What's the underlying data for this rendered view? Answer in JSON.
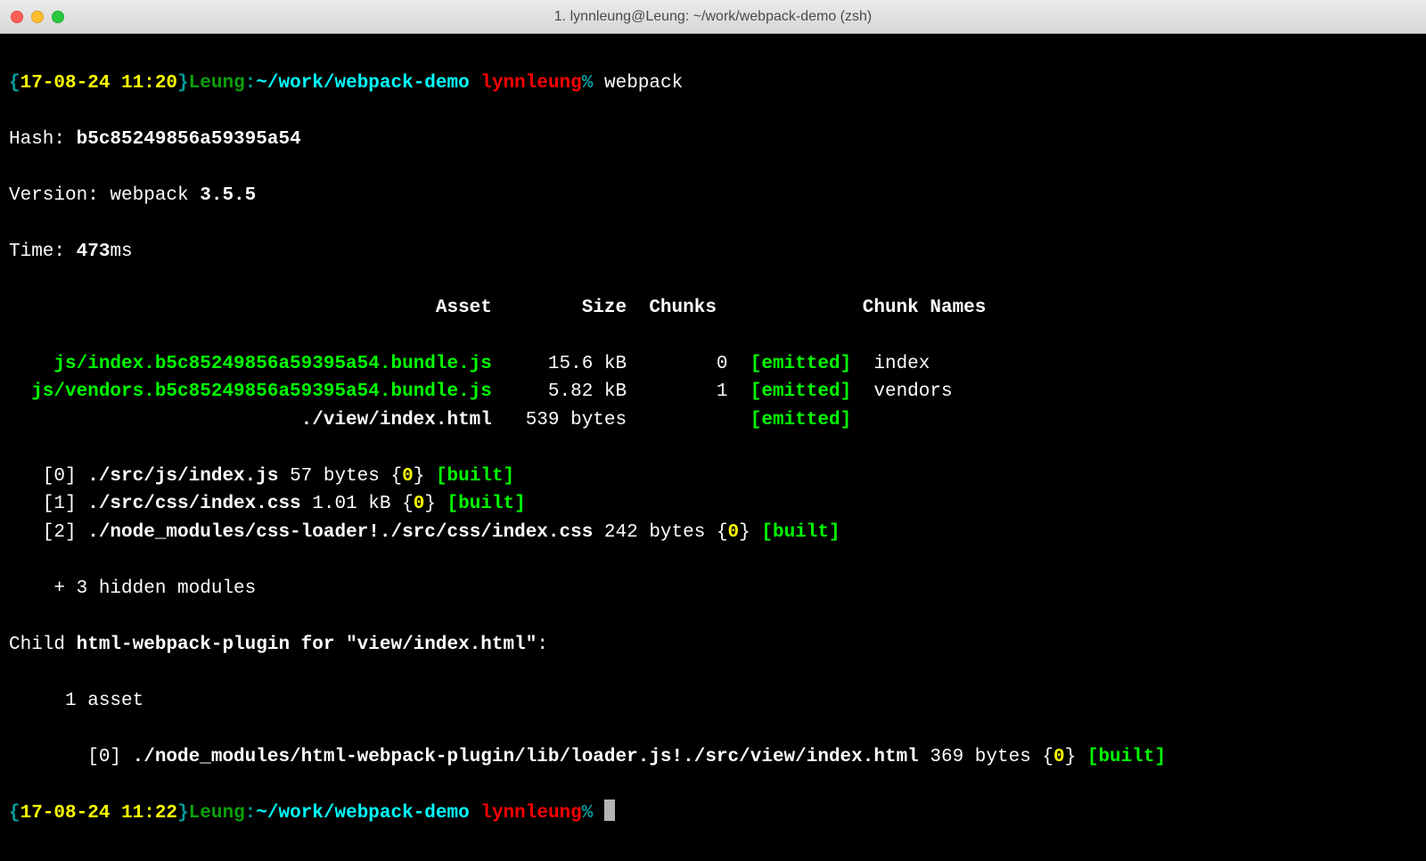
{
  "window": {
    "title": "1. lynnleung@Leung: ~/work/webpack-demo (zsh)"
  },
  "prompt1": {
    "open": "{",
    "timestamp": "17-08-24 11:20",
    "close": "}",
    "host": "Leung",
    "sep": ":",
    "path": "~/work/webpack-demo",
    "user": "lynnleung",
    "pct": "%",
    "command": "webpack"
  },
  "hash": {
    "label": "Hash: ",
    "value": "b5c85249856a59395a54"
  },
  "version": {
    "label": "Version: ",
    "prefix": "webpack ",
    "value": "3.5.5"
  },
  "time": {
    "label": "Time: ",
    "value": "473",
    "suffix": "ms"
  },
  "header": {
    "asset": "Asset",
    "size": "Size",
    "chunks": "Chunks",
    "chunkNames": "Chunk Names"
  },
  "assets": [
    {
      "asset": "js/index.b5c85249856a59395a54.bundle.js",
      "size": "15.6 kB",
      "chunk": "0",
      "status": "[emitted]",
      "name": "index",
      "assetGreen": true
    },
    {
      "asset": "js/vendors.b5c85249856a59395a54.bundle.js",
      "size": "5.82 kB",
      "chunk": "1",
      "status": "[emitted]",
      "name": "vendors",
      "assetGreen": true
    },
    {
      "asset": "./view/index.html",
      "size": "539 bytes",
      "chunk": "",
      "status": "[emitted]",
      "name": "",
      "assetGreen": false
    }
  ],
  "modules": [
    {
      "idx": "[0]",
      "path": "./src/js/index.js",
      "size": "57 bytes",
      "chunk": "0",
      "status": "[built]"
    },
    {
      "idx": "[1]",
      "path": "./src/css/index.css",
      "size": "1.01 kB",
      "chunk": "0",
      "status": "[built]"
    },
    {
      "idx": "[2]",
      "path": "./node_modules/css-loader!./src/css/index.css",
      "size": "242 bytes",
      "chunk": "0",
      "status": "[built]"
    }
  ],
  "hidden": "    + 3 hidden modules",
  "child": {
    "prefix": "Child ",
    "label": "html-webpack-plugin for \"view/index.html\"",
    "colon": ":",
    "asset": "     1 asset",
    "mod": {
      "idx": "[0]",
      "path": "./node_modules/html-webpack-plugin/lib/loader.js!./src/view/index.html",
      "size": "369 bytes",
      "chunk": "0",
      "status": "[built]"
    }
  },
  "prompt2": {
    "open": "{",
    "timestamp": "17-08-24 11:22",
    "close": "}",
    "host": "Leung",
    "sep": ":",
    "path": "~/work/webpack-demo",
    "user": "lynnleung",
    "pct": "%"
  },
  "braces": {
    "open": "{",
    "close": "}"
  }
}
